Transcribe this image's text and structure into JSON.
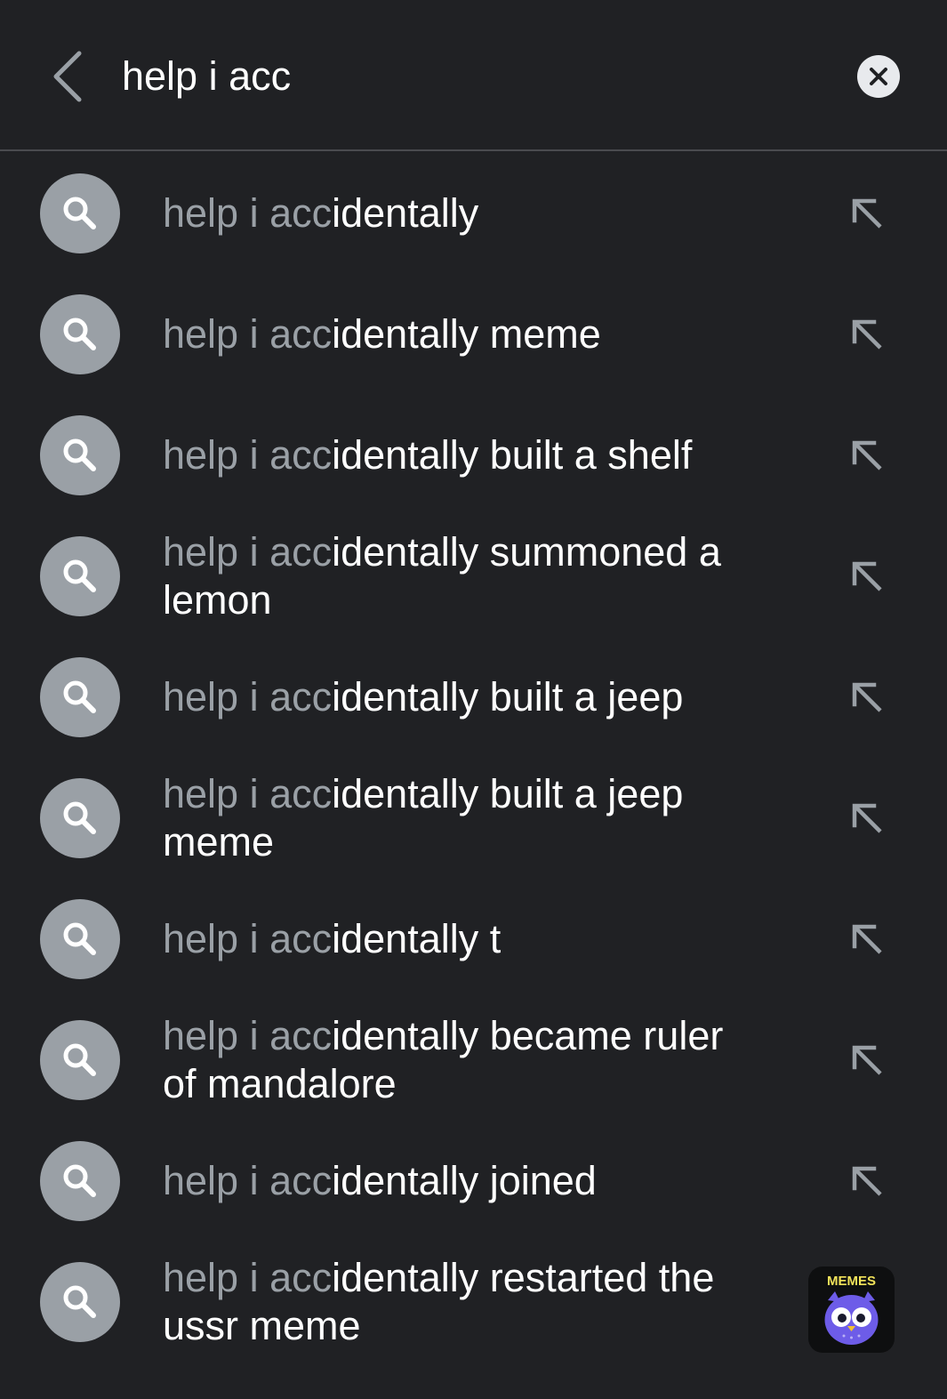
{
  "search": {
    "query": "help i acc",
    "placeholder": ""
  },
  "icons": {
    "back": "chevron-left-icon",
    "clear": "close-circle-icon",
    "suggestion": "search-icon",
    "fill_query": "arrow-up-left-icon"
  },
  "colors": {
    "background": "#202124",
    "typed_text": "#9aa0a6",
    "completion_text": "#ffffff",
    "icon_circle": "#9aa0a6",
    "divider": "#4a4b4f"
  },
  "suggestions": [
    {
      "typed": "help i acc",
      "completion": "identally"
    },
    {
      "typed": "help i acc",
      "completion": "identally meme"
    },
    {
      "typed": "help i acc",
      "completion": "identally built a shelf"
    },
    {
      "typed": "help i acc",
      "completion": "identally summoned a lemon"
    },
    {
      "typed": "help i acc",
      "completion": "identally built a jeep"
    },
    {
      "typed": "help i acc",
      "completion": "identally built a jeep meme"
    },
    {
      "typed": "help i acc",
      "completion": "identally t"
    },
    {
      "typed": "help i acc",
      "completion": "identally became ruler of mandalore"
    },
    {
      "typed": "help i acc",
      "completion": "identally joined"
    },
    {
      "typed": "help i acc",
      "completion": "identally restarted the ussr meme"
    }
  ],
  "watermark": {
    "text": "MEMES"
  }
}
